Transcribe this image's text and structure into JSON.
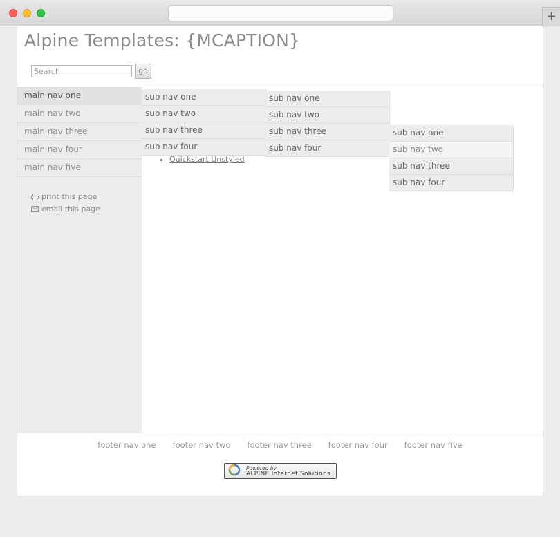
{
  "site": {
    "title": "Alpine Templates: {MCAPTION}"
  },
  "search": {
    "placeholder": "Search",
    "go_label": "go"
  },
  "main_nav": [
    {
      "label": "main nav one"
    },
    {
      "label": "main nav two"
    },
    {
      "label": "main nav three"
    },
    {
      "label": "main nav four"
    },
    {
      "label": "main nav five"
    }
  ],
  "utility": {
    "print_label": "print this page",
    "email_label": "email this page"
  },
  "subnav_level1": [
    "sub nav one",
    "sub nav two",
    "sub nav three",
    "sub nav four"
  ],
  "subnav_level2": [
    "sub nav one",
    "sub nav two",
    "sub nav three",
    "sub nav four"
  ],
  "subnav_level3": [
    "sub nav one",
    "sub nav two",
    "sub nav three",
    "sub nav four"
  ],
  "content": {
    "quickstart_link": "Quickstart Unstyled"
  },
  "footer": {
    "nav": [
      "footer nav one",
      "footer nav two",
      "footer nav three",
      "footer nav four",
      "footer nav five"
    ],
    "powered_line1": "Powered by",
    "powered_line2": "ALPINE Internet Solutions"
  }
}
